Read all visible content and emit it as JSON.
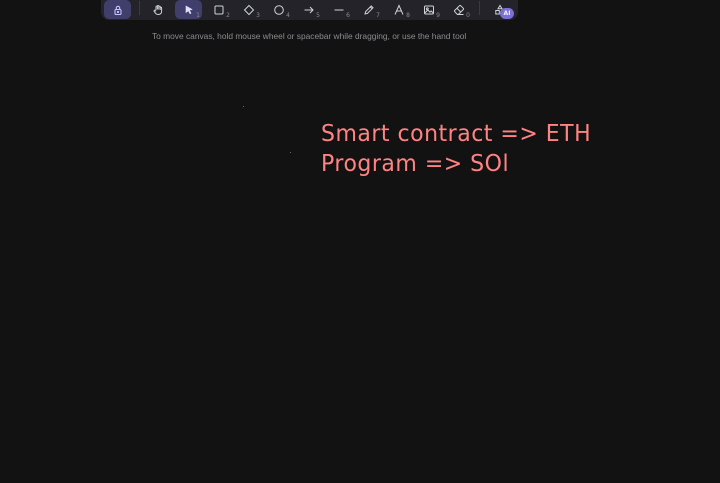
{
  "toolbar": {
    "tools": [
      {
        "name": "lock",
        "icon": "lock-icon",
        "shortcut": "",
        "active": true
      },
      {
        "name": "hand",
        "icon": "hand-icon",
        "shortcut": "",
        "active": false
      },
      {
        "name": "selection",
        "icon": "cursor-icon",
        "shortcut": "1",
        "active": true
      },
      {
        "name": "rectangle",
        "icon": "square-icon",
        "shortcut": "2",
        "active": false
      },
      {
        "name": "diamond",
        "icon": "diamond-icon",
        "shortcut": "3",
        "active": false
      },
      {
        "name": "ellipse",
        "icon": "circle-icon",
        "shortcut": "4",
        "active": false
      },
      {
        "name": "arrow",
        "icon": "arrow-right-icon",
        "shortcut": "5",
        "active": false
      },
      {
        "name": "line",
        "icon": "line-icon",
        "shortcut": "6",
        "active": false
      },
      {
        "name": "draw",
        "icon": "pencil-icon",
        "shortcut": "7",
        "active": false
      },
      {
        "name": "text",
        "icon": "text-icon",
        "shortcut": "8",
        "active": false
      },
      {
        "name": "image",
        "icon": "image-icon",
        "shortcut": "9",
        "active": false
      },
      {
        "name": "eraser",
        "icon": "eraser-icon",
        "shortcut": "0",
        "active": false
      },
      {
        "name": "extra-tools",
        "icon": "shapes-icon",
        "shortcut": "",
        "active": false
      }
    ],
    "ai_badge": "AI"
  },
  "hint": "To move canvas, hold mouse wheel or spacebar while dragging, or use the hand tool",
  "canvas": {
    "text_lines": [
      "Smart contract => ETH",
      "Program => SOl"
    ],
    "text_color": "#ff8383",
    "background": "#121212"
  },
  "colors": {
    "toolbar_bg": "#232329",
    "active_tool_bg": "#403e6a",
    "hint_text": "#8b8b93",
    "accent": "#7a70d6"
  }
}
